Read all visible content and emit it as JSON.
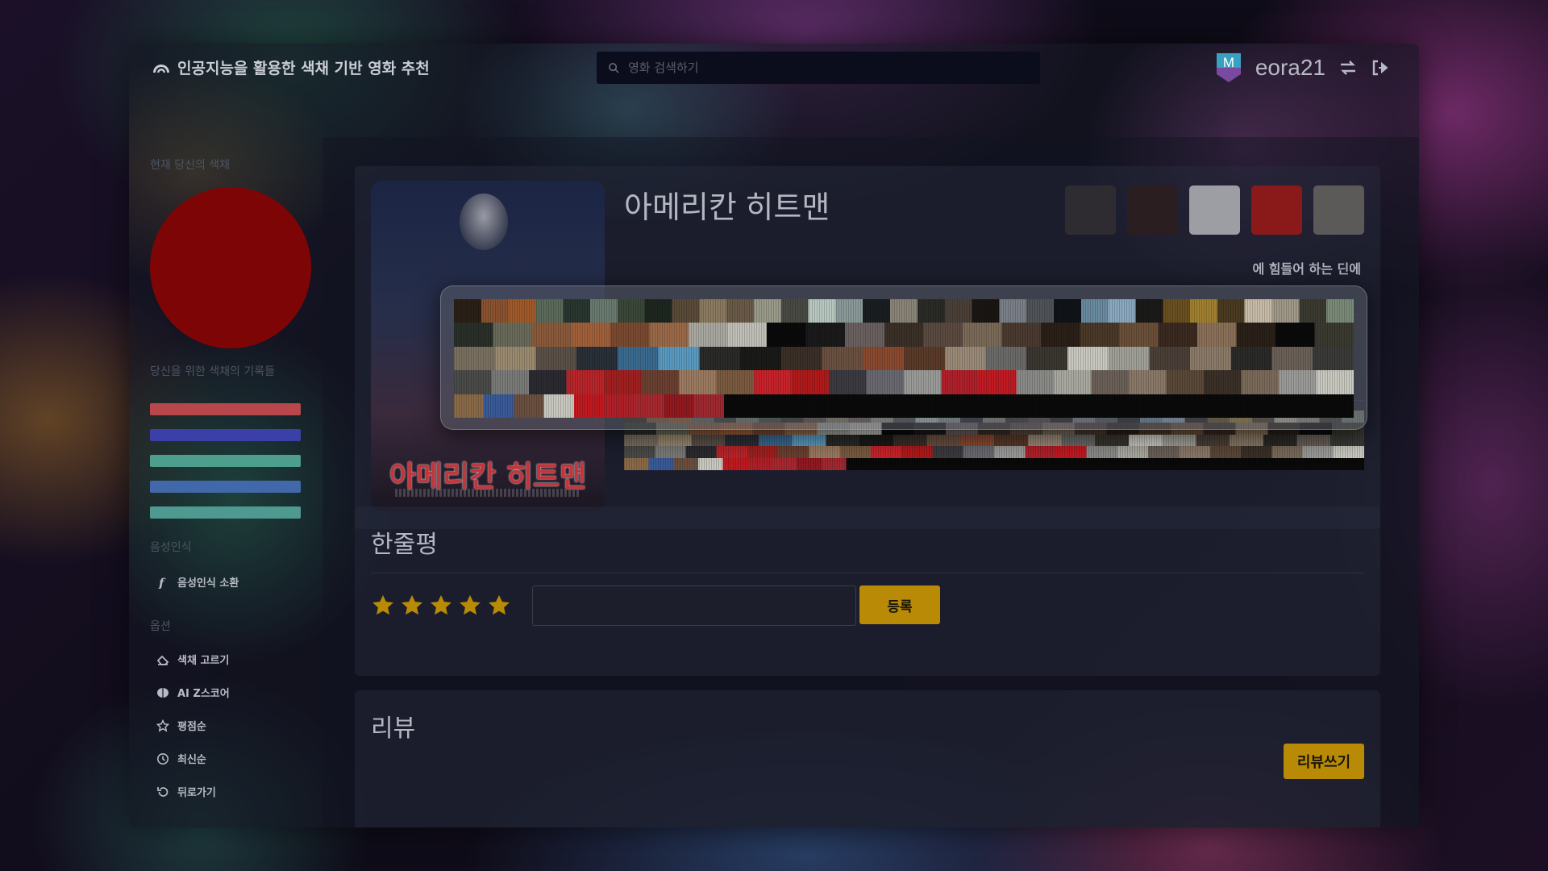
{
  "header": {
    "brand_title": "인공지능을 활용한 색채 기반 영화 추천",
    "search_placeholder": "영화 검색하기",
    "username": "eora21",
    "badge_letter": "M"
  },
  "sidebar": {
    "current_color_label": "현재 당신의 색채",
    "current_color": "#7e0505",
    "history_label": "당신을 위한 색채의 기록들",
    "history_colors": [
      "#b8474c",
      "#3b3fa8",
      "#4d9e8c",
      "#4168a8",
      "#4e9a90"
    ],
    "voice_label": "음성인식",
    "voice_item": "음성인식 소환",
    "options_label": "옵션",
    "options": [
      {
        "label": "색채 고르기",
        "icon": "palette-icon"
      },
      {
        "label": "AI Z스코어",
        "icon": "brain-icon"
      },
      {
        "label": "평점순",
        "icon": "star-outline-icon"
      },
      {
        "label": "최신순",
        "icon": "clock-icon"
      },
      {
        "label": "뒤로가기",
        "icon": "undo-icon"
      }
    ]
  },
  "movie": {
    "title": "아메리칸 히트맨",
    "poster_title": "아메리칸 히트맨",
    "palette": [
      "#2e2c30",
      "#2a1e20",
      "#9c9ea4",
      "#8a1a1a",
      "#5c5a58"
    ],
    "plot_excerpt": "에 힘들어 하는 딘에"
  },
  "oneline": {
    "heading": "한줄평",
    "rating_stars": 5,
    "input_value": "",
    "submit_label": "등록"
  },
  "reviews": {
    "heading": "리뷰",
    "write_label": "리뷰쓰기"
  },
  "barcode_rows": [
    [
      "#2a2016",
      "#8a5230",
      "#a05a2a",
      "#5a6a5a",
      "#2a3630",
      "#6a7a70",
      "#3a4838",
      "#1e2620",
      "#5a4a38",
      "#8a7a60",
      "#6a5a48",
      "#9a9a8a",
      "#4a4a44",
      "#b8c8c0",
      "#8a9a98",
      "#1a1e20",
      "#8a8478",
      "#2a2a26",
      "#4a4038",
      "#1a1614",
      "#7a8088",
      "#505458",
      "#101418",
      "#6a8aa0",
      "#8aa8c0",
      "#1a1a18",
      "#6a5020",
      "#a08030",
      "#4a3a20",
      "#c8bca8",
      "#a09888",
      "#3a3a30",
      "#7a8a78"
    ],
    [
      "#2a3028",
      "#6a6a5a",
      "#8a5a3a",
      "#a0603a",
      "#7a4a30",
      "#9a6a48",
      "#a8a8a0",
      "#c0c0b8",
      "#0a0a0a",
      "#1a1a1a",
      "#6a6060",
      "#3a3028",
      "#5a4a40",
      "#7a6a58",
      "#4a3a30",
      "#2a2018",
      "#4a3828",
      "#6a5038",
      "#3a2a20",
      "#8a7058",
      "#2a2018",
      "#0a0a0a",
      "#3a3a30"
    ],
    [
      "#7a7060",
      "#9a8a70",
      "#5a5048",
      "#2a3038",
      "#3a6a90",
      "#5a9ac0",
      "#2a2a28",
      "#1a1a18",
      "#3a3028",
      "#6a5040",
      "#8a4a30",
      "#5a3a28",
      "#9a8a78",
      "#6a6a68",
      "#3a3630",
      "#c8c8c0",
      "#a0a098",
      "#4a4038",
      "#8a7a68",
      "#2a2a28",
      "#6a6058",
      "#3a3a38"
    ],
    [
      "#4a4a48",
      "#7a7a78",
      "#2a2a30",
      "#b8252a",
      "#a02020",
      "#6a4030",
      "#9a7a60",
      "#7a5a40",
      "#c8222a",
      "#b01a1a",
      "#3a3a40",
      "#6a6870",
      "#9a9a98",
      "#b0202a",
      "#c01a22",
      "#8a8a88",
      "#a8a8a0",
      "#6a6058",
      "#8a7868",
      "#5a4838",
      "#3a3028",
      "#7a6a5a",
      "#9a9a98",
      "#c8c8c0"
    ],
    [
      "#8a6a48",
      "#3a5a98",
      "#6a5040",
      "#c8c8c0",
      "#c01a20",
      "#b02028",
      "#a82830",
      "#901a20",
      "#a02830",
      "#0a0a0a",
      "#0a0a0a",
      "#0a0a0a",
      "#0a0a0a",
      "#0a0a0a",
      "#0a0a0a",
      "#0a0a0a",
      "#0a0a0a",
      "#0a0a0a",
      "#0a0a0a",
      "#0a0a0a",
      "#0a0a0a",
      "#0a0a0a",
      "#0a0a0a",
      "#0a0a0a",
      "#0a0a0a",
      "#0a0a0a",
      "#0a0a0a",
      "#0a0a0a",
      "#0a0a0a",
      "#0a0a0a"
    ]
  ]
}
